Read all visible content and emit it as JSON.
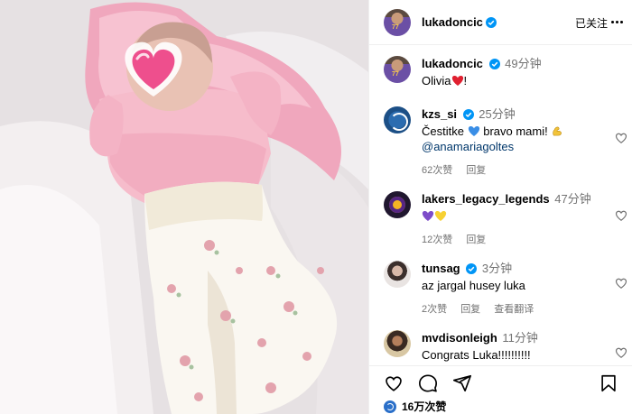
{
  "post": {
    "author": "lukadoncic",
    "follow_status": "已关注",
    "caption_time": "49分钟",
    "caption_text": "Olivia"
  },
  "comments": [
    {
      "user": "kzs_si",
      "time": "25分钟",
      "text": "Čestitke",
      "text_after": "bravo mami!",
      "mention": "@anamariagoltes",
      "likes": "62次赞",
      "reply": "回复",
      "extra": ""
    },
    {
      "user": "lakers_legacy_legends",
      "time": "47分钟",
      "text": "",
      "text_after": "",
      "mention": "",
      "likes": "12次赞",
      "reply": "回复",
      "extra": ""
    },
    {
      "user": "tunsag",
      "time": "3分钟",
      "text": "az jargal husey luka",
      "text_after": "",
      "mention": "",
      "likes": "2次赞",
      "reply": "回复",
      "extra": "查看翻译"
    },
    {
      "user": "mvdisonleigh",
      "time": "11分钟",
      "text": "Congrats Luka!!!!!!!!!!",
      "text_after": "",
      "mention": "",
      "likes": "",
      "reply": "",
      "extra": ""
    }
  ],
  "footer": {
    "likes_count": "16万次赞"
  },
  "icons": {
    "verified": "verified-badge-icon",
    "like": "heart-icon",
    "comment": "comment-icon",
    "share": "paper-plane-icon",
    "save": "bookmark-icon"
  },
  "colors": {
    "verified_blue": "#0095f6",
    "meta_gray": "#737373",
    "mention_blue": "#00376b"
  }
}
